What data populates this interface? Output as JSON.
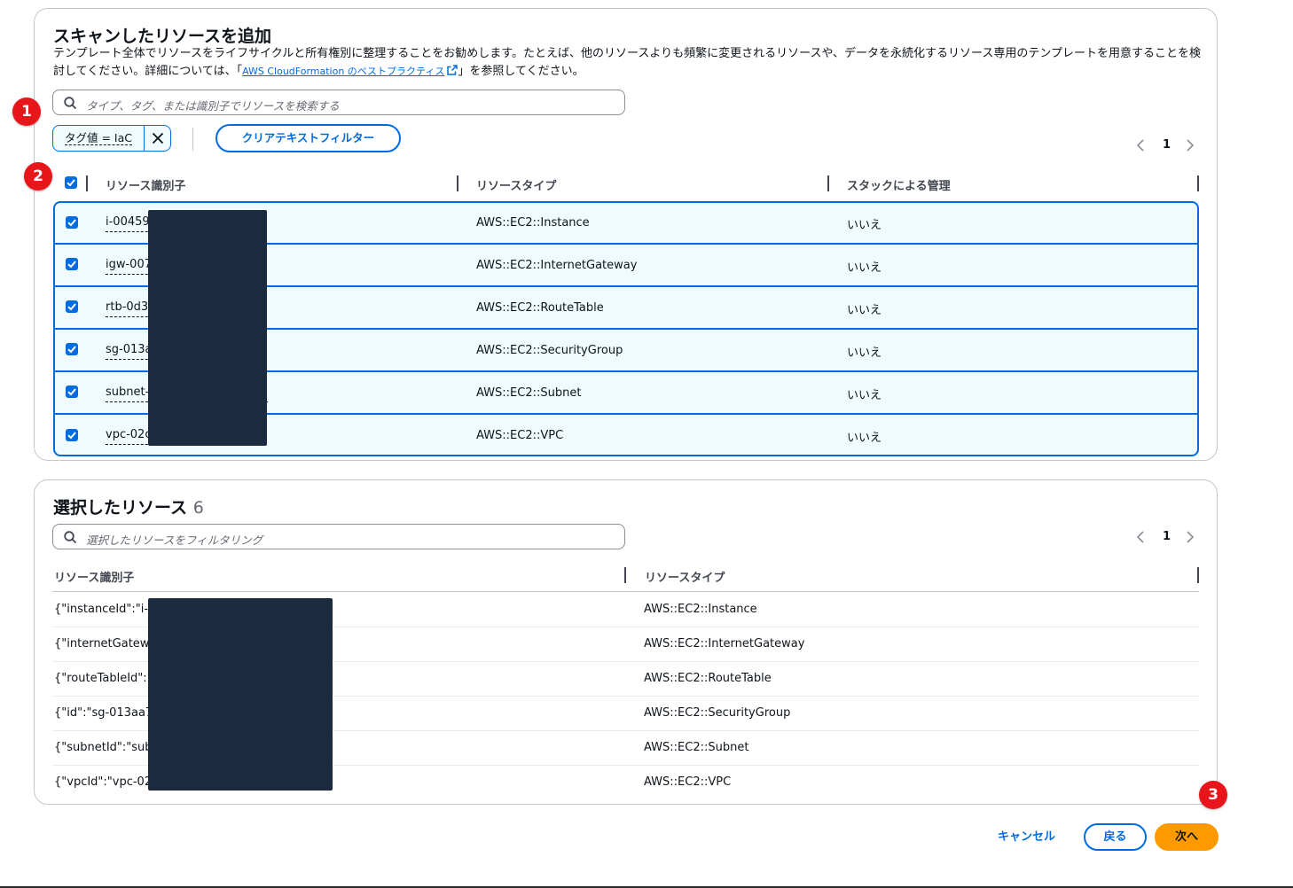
{
  "panel1": {
    "title": "スキャンしたリソースを追加",
    "description_before": "テンプレート全体でリソースをライフサイクルと所有権別に整理することをお勧めします。たとえば、他のリソースよりも頻繁に変更されるリソースや、データを永続化するリソース専用のテンプレートを用意することを検討してください。詳細については、「",
    "link_text": "AWS CloudFormation のベストプラクティス",
    "description_after": "」を参照してください。",
    "search_placeholder": "タイプ、タグ、または識別子でリソースを検索する",
    "filter_token": "タグ値 = IaC",
    "clear_filter_button": "クリアテキストフィルター",
    "page": "1",
    "columns": [
      "リソース識別子",
      "リソースタイプ",
      "スタックによる管理"
    ],
    "rows": [
      {
        "id": "i-00459",
        "type": "AWS::EC2::Instance",
        "managed": "いいえ"
      },
      {
        "id": "igw-007",
        "type": "AWS::EC2::InternetGateway",
        "managed": "いいえ"
      },
      {
        "id": "rtb-0d3",
        "type": "AWS::EC2::RouteTable",
        "managed": "いいえ"
      },
      {
        "id": "sg-013a",
        "type": "AWS::EC2::SecurityGroup",
        "managed": "いいえ"
      },
      {
        "id": "subnet-",
        "type": "AWS::EC2::Subnet",
        "managed": "いいえ"
      },
      {
        "id": "vpc-02c",
        "type": "AWS::EC2::VPC",
        "managed": "いいえ"
      }
    ]
  },
  "panel2": {
    "title": "選択したリソース",
    "count": "6",
    "search_placeholder": "選択したリソースをフィルタリング",
    "page": "1",
    "columns": [
      "リソース識別子",
      "リソースタイプ"
    ],
    "rows": [
      {
        "id": "{\"instanceId\":\"i-0",
        "type": "AWS::EC2::Instance"
      },
      {
        "id": "{\"internetGatewa",
        "type": "AWS::EC2::InternetGateway"
      },
      {
        "id": "{\"routeTableId\":\"",
        "type": "AWS::EC2::RouteTable"
      },
      {
        "id": "{\"id\":\"sg-013aa7",
        "type": "AWS::EC2::SecurityGroup"
      },
      {
        "id": "{\"subnetId\":\"subr",
        "type": "AWS::EC2::Subnet"
      },
      {
        "id": "{\"vpcId\":\"vpc-02c",
        "type": "AWS::EC2::VPC"
      }
    ]
  },
  "badges": [
    "1",
    "2",
    "3"
  ],
  "footer": {
    "cancel": "キャンセル",
    "back": "戻る",
    "next": "次へ"
  },
  "colors": {
    "accent": "#006ce0",
    "primary_button": "#ff9900",
    "badge": "#e8161a",
    "redaction": "#1c2a40"
  }
}
